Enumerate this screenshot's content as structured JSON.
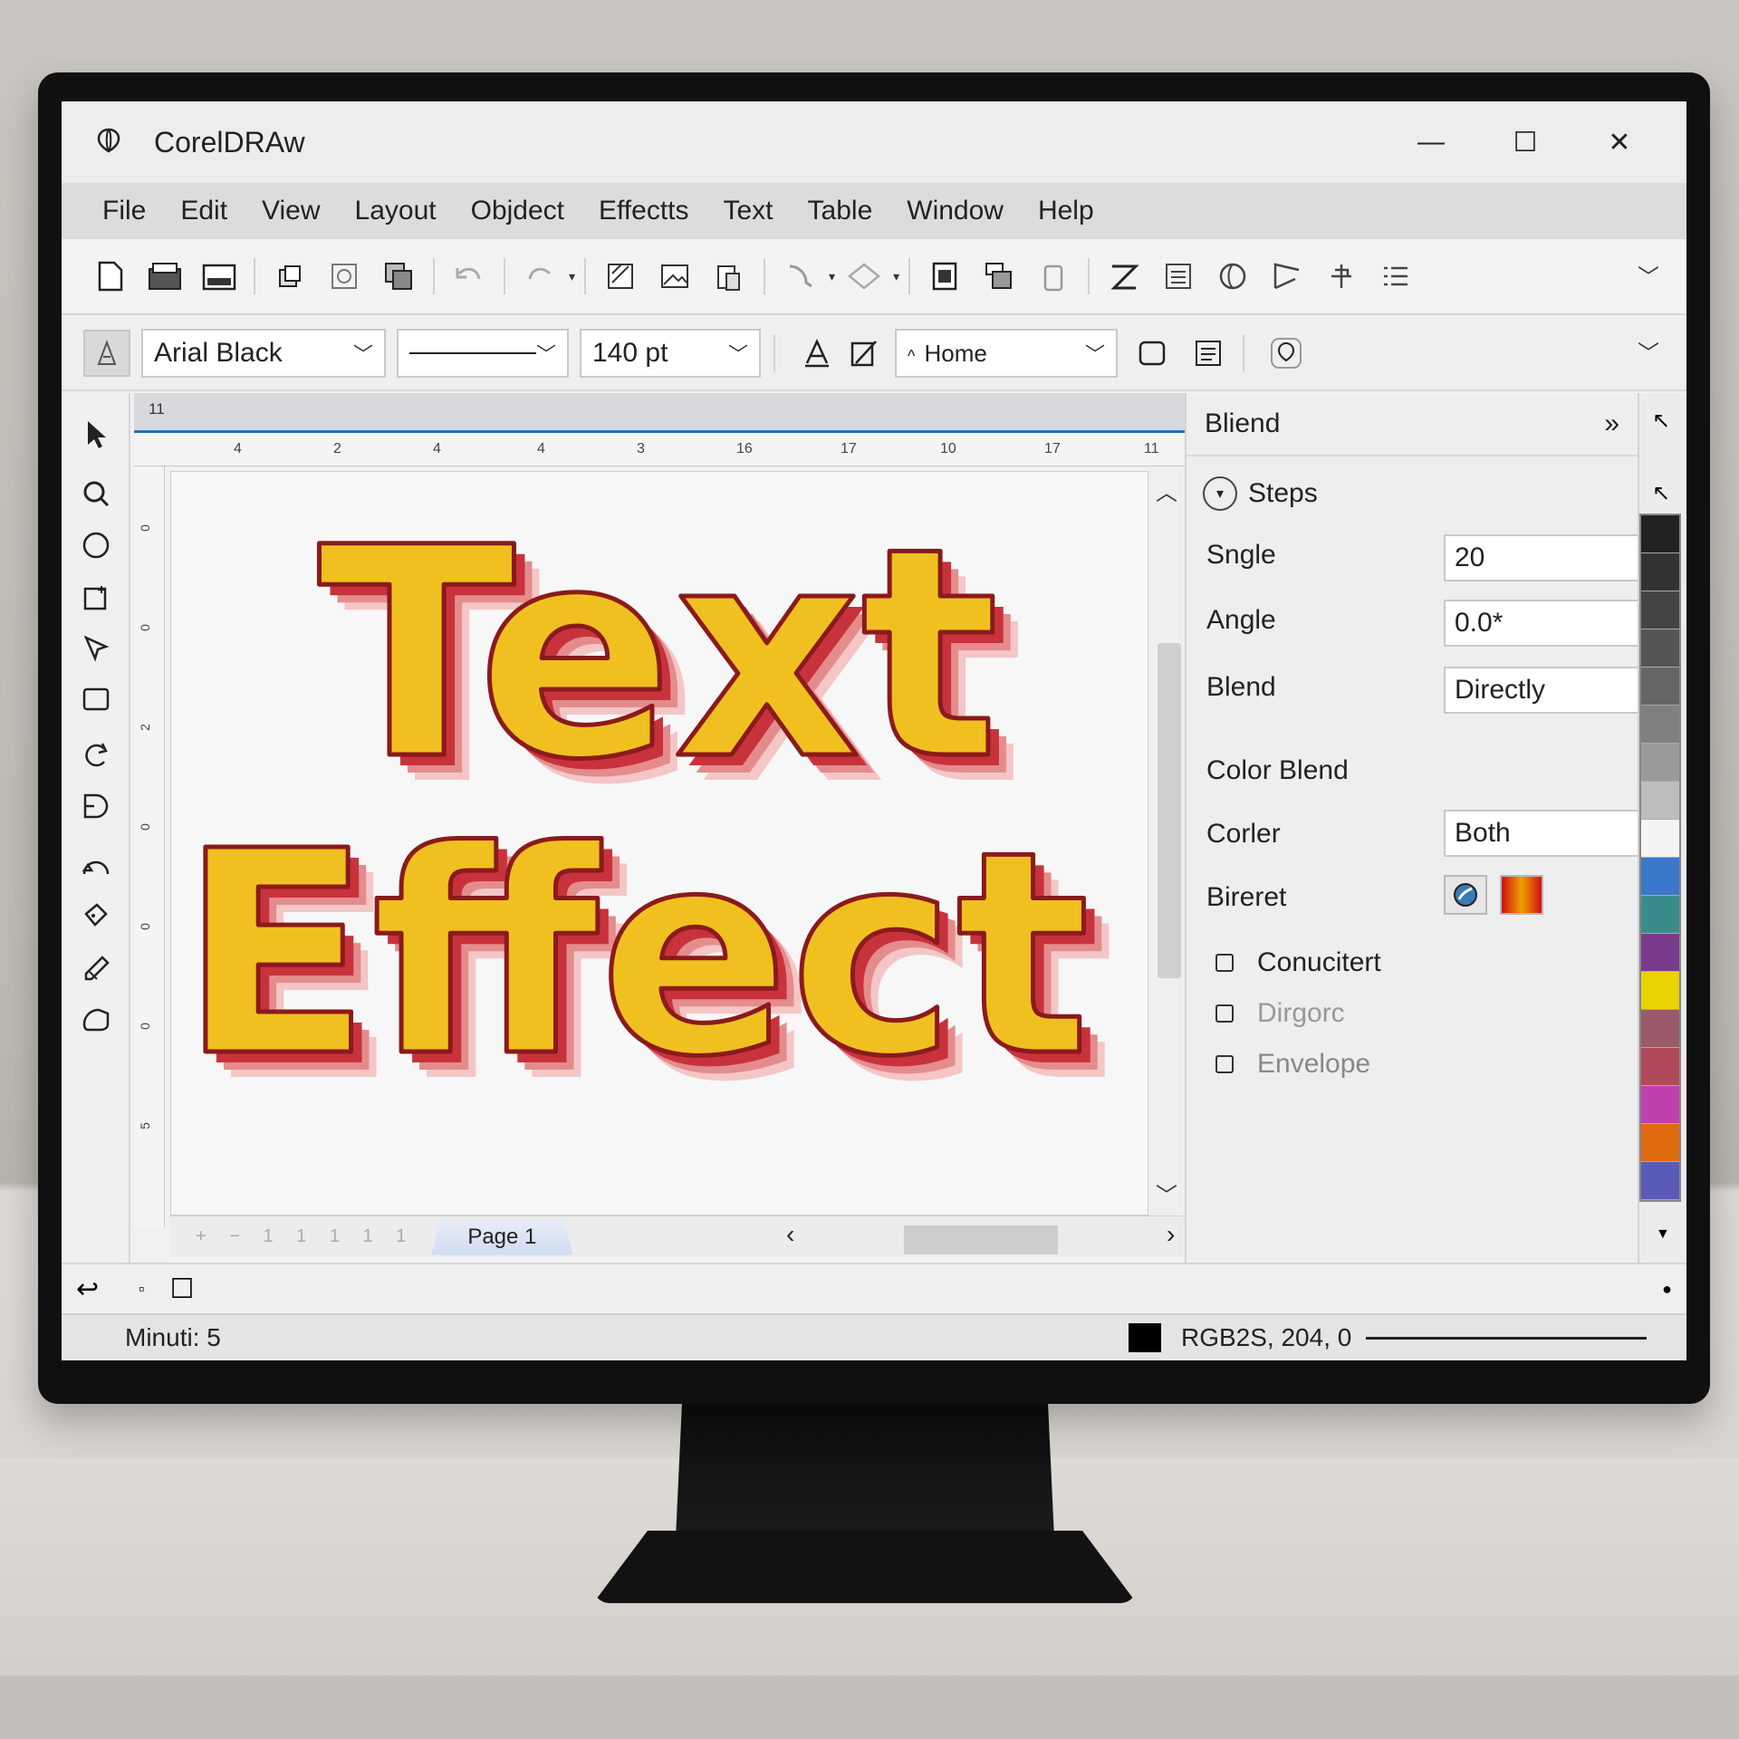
{
  "window": {
    "title": "CorelDRAw",
    "minimize": "—",
    "maximize": "☐",
    "close": "✕"
  },
  "menu": [
    "File",
    "Edit",
    "View",
    "Layout",
    "Objdect",
    "Effectts",
    "Text",
    "Table",
    "Window",
    "Help"
  ],
  "propbar": {
    "font": "Arial Black",
    "size": "140 pt",
    "home": "Home"
  },
  "ruler": {
    "band": "11",
    "h_ticks": [
      "4",
      "2",
      "4",
      "4",
      "3",
      "16",
      "17",
      "10",
      "17",
      "11"
    ],
    "v_ticks": [
      "0",
      "0",
      "2",
      "0",
      "0",
      "0",
      "5"
    ]
  },
  "canvas": {
    "line1": "Text",
    "line2": "Effect",
    "fill": "#f0c020",
    "outline": "#8b1a1a",
    "shadow": "#c8323c"
  },
  "pagebar": {
    "nav": "+ − 1 1 1 1 1",
    "page_tab": "Page 1"
  },
  "docker": {
    "title": "Bliend",
    "section": "Steps",
    "fields": [
      {
        "label": "Sngle",
        "value": "20"
      },
      {
        "label": "Angle",
        "value": "0.0*"
      },
      {
        "label": "Blend",
        "value": "Directly"
      }
    ],
    "color_blend_label": "Color Blend",
    "corler": {
      "label": "Corler",
      "value": "Both"
    },
    "bireret_label": "Bireret",
    "checks": [
      {
        "label": "Conucitert",
        "enabled": true
      },
      {
        "label": "Dirgorc",
        "enabled": false
      },
      {
        "label": "Envelope",
        "enabled": false
      }
    ]
  },
  "palette": [
    "#222222",
    "#333333",
    "#444444",
    "#555555",
    "#666666",
    "#808080",
    "#9a9a9a",
    "#bdbdbd",
    "#f4f4f4",
    "#3a78c9",
    "#3a8c8c",
    "#7a3b8c",
    "#e8d200",
    "#9a5a6a",
    "#b04a5a",
    "#c040b0",
    "#e06a10",
    "#5a5ab8"
  ],
  "status": {
    "left": "Minuti: 5",
    "color": "RGB2S, 204, 0"
  },
  "colors": {
    "accent": "#2a6fb8"
  }
}
